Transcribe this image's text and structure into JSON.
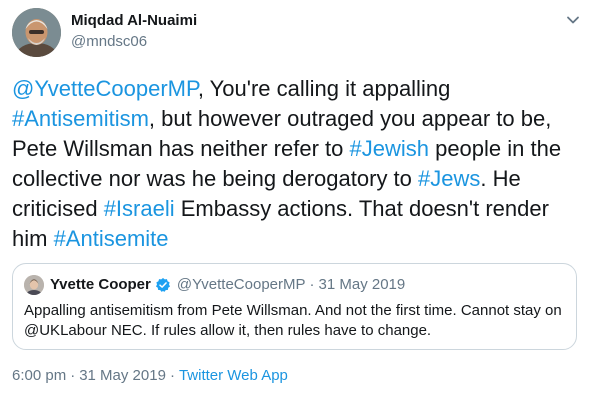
{
  "author": {
    "name": "Miqdad Al-Nuaimi",
    "handle": "@mndsc06"
  },
  "tweet": {
    "lines": [
      [
        {
          "t": "@YvetteCooperMP",
          "link": true
        },
        {
          "t": ", You're calling it appalling",
          "link": false
        }
      ],
      [
        {
          "t": "#Antisemitism",
          "link": true
        },
        {
          "t": ", but however outraged you appear to be,",
          "link": false
        }
      ],
      [
        {
          "t": "Pete Willsman has neither refer to ",
          "link": false
        },
        {
          "t": "#Jewish",
          "link": true
        },
        {
          "t": " people in the",
          "link": false
        }
      ],
      [
        {
          "t": "collective nor was he being derogatory to ",
          "link": false
        },
        {
          "t": "#Jews",
          "link": true
        },
        {
          "t": ". He",
          "link": false
        }
      ],
      [
        {
          "t": "criticised ",
          "link": false
        },
        {
          "t": "#Israeli",
          "link": true
        },
        {
          "t": " Embassy actions. That doesn't render",
          "link": false
        }
      ],
      [
        {
          "t": "him ",
          "link": false
        },
        {
          "t": "#Antisemite",
          "link": true
        }
      ]
    ]
  },
  "quoted": {
    "name": "Yvette Cooper",
    "handle": "@YvetteCooperMP",
    "separator": "·",
    "date": "31 May 2019",
    "text_lines": [
      "Appalling antisemitism from Pete Willsman. And not the first time. Cannot stay on",
      "@UKLabour NEC. If rules allow it, then rules have to change."
    ]
  },
  "footer": {
    "time": "6:00 pm",
    "separator": "·",
    "date": "31 May 2019",
    "app": "Twitter Web App"
  },
  "colors": {
    "link": "#1b95e0",
    "text": "#14171a",
    "secondary": "#657786",
    "border": "#ccd6dd",
    "verified": "#1da1f2"
  },
  "icons": {
    "menu": "chevron-down-icon",
    "verified": "verified-badge-icon"
  }
}
